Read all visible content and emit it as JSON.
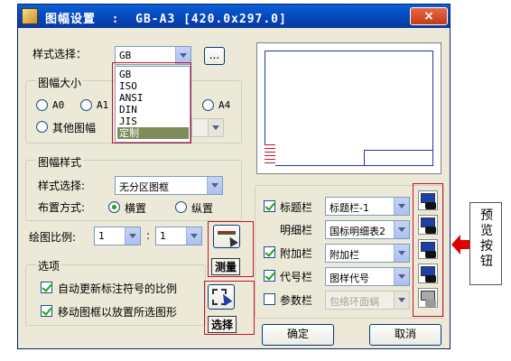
{
  "dialog": {
    "title": "图幅设置  :  GB-A3 [420.0x297.0]",
    "close_label": "×"
  },
  "style_select": {
    "label": "样式选择：",
    "value": "GB",
    "more_button": "...",
    "options": [
      "GB",
      "ISO",
      "ANSI",
      "DIN",
      "JIS",
      "定制"
    ],
    "highlighted": "定制"
  },
  "size_group": {
    "title": "图幅大小",
    "options": [
      "A0",
      "A1",
      "A4"
    ],
    "other_label": "其他图幅"
  },
  "frame_style": {
    "title": "图幅样式",
    "select_label": "样式选择:",
    "select_value": "无分区图框",
    "layout_label": "布置方式:",
    "layout_options": [
      "横置",
      "纵置"
    ],
    "layout_selected": "横置"
  },
  "scale": {
    "label": "绘图比例:",
    "left_value": "1",
    "separator": ":",
    "right_value": "1"
  },
  "options_group": {
    "title": "选项",
    "auto_update": "自动更新标注符号的比例",
    "move_frame": "移动图框以放置所选图形"
  },
  "callouts": {
    "measure": "测量",
    "select": "选择",
    "preview_note": "预览按钮"
  },
  "attachments": {
    "title_bar": {
      "label": "标题栏",
      "value": "标题栏-1",
      "checked": true
    },
    "detail_bar": {
      "label": "明细栏",
      "value": "国标明细表2"
    },
    "extra_bar": {
      "label": "附加栏",
      "value": "附加栏",
      "checked": true
    },
    "code_bar": {
      "label": "代号栏",
      "value": "图样代号",
      "checked": true
    },
    "param_bar": {
      "label": "参数栏",
      "value": "包络环面蜗",
      "checked": false
    }
  },
  "buttons": {
    "ok": "确定",
    "cancel": "取消"
  },
  "colors": {
    "title_bar": "#0a5fd6",
    "highlight_red": "#c8102e",
    "arrow_red": "#e00000",
    "preview_border": "#2233aa"
  }
}
